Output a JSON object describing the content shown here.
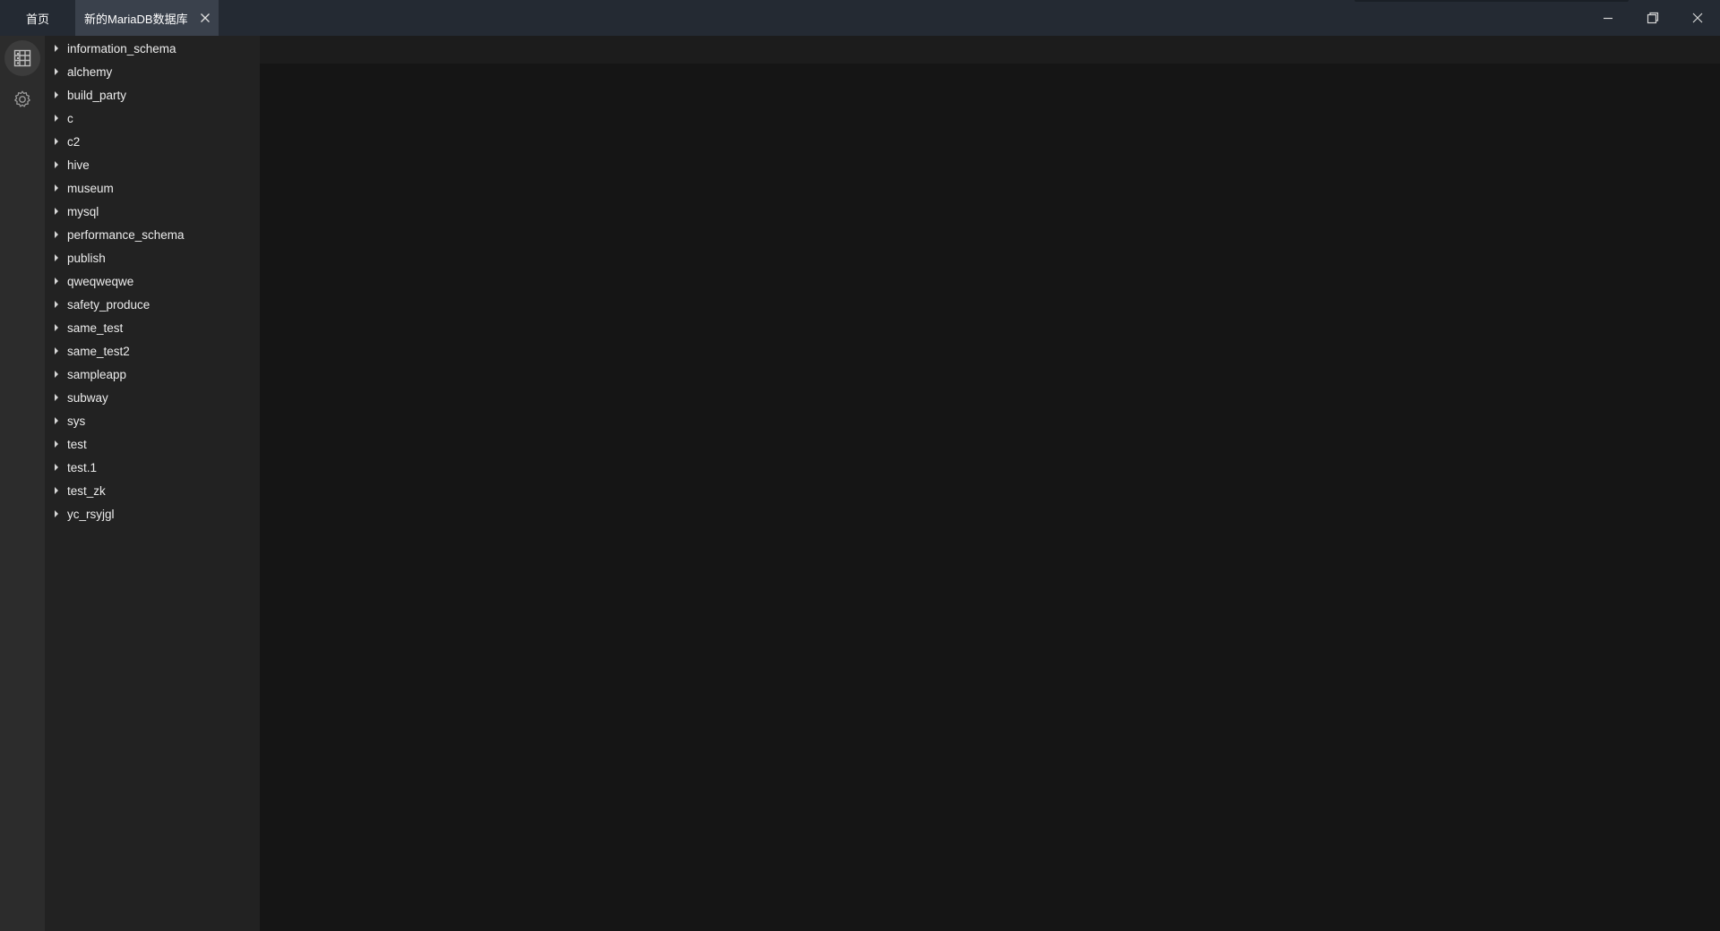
{
  "window": {
    "tabs": [
      {
        "label": "首页",
        "active": false
      },
      {
        "label": "新的MariaDB数据库",
        "active": true,
        "closable": true
      }
    ],
    "controls": {
      "minimize_icon": "minimize-icon",
      "restore_icon": "restore-icon",
      "close_icon": "close-icon"
    }
  },
  "activitybar": {
    "items": [
      {
        "icon": "database-icon",
        "active": true
      },
      {
        "icon": "gear-icon",
        "active": false
      }
    ]
  },
  "sidebar": {
    "databases": [
      {
        "label": "information_schema"
      },
      {
        "label": "alchemy"
      },
      {
        "label": "build_party"
      },
      {
        "label": "c"
      },
      {
        "label": "c2"
      },
      {
        "label": "hive"
      },
      {
        "label": "museum"
      },
      {
        "label": "mysql"
      },
      {
        "label": "performance_schema"
      },
      {
        "label": "publish"
      },
      {
        "label": "qweqweqwe"
      },
      {
        "label": "safety_produce"
      },
      {
        "label": "same_test"
      },
      {
        "label": "same_test2"
      },
      {
        "label": "sampleapp"
      },
      {
        "label": "subway"
      },
      {
        "label": "sys"
      },
      {
        "label": "test"
      },
      {
        "label": "test.1"
      },
      {
        "label": "test_zk"
      },
      {
        "label": "yc_rsyjgl"
      }
    ]
  },
  "colors": {
    "titlebar": "#242a33",
    "active_tab": "#3a414c",
    "activitybar": "#2c2c2c",
    "sidebar": "#222222",
    "main": "#151515"
  }
}
